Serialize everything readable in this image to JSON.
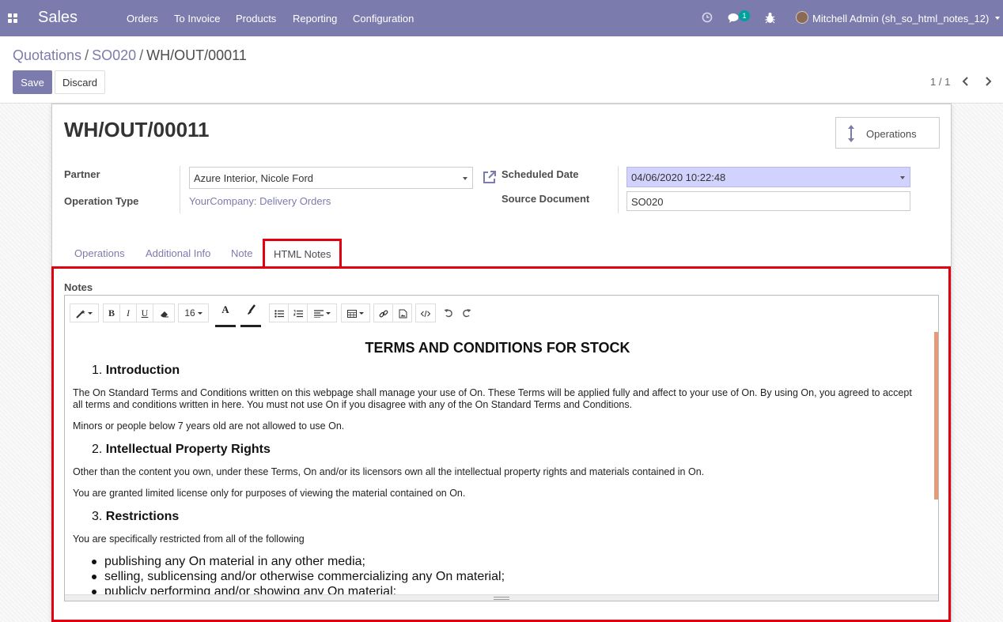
{
  "navbar": {
    "brand": "Sales",
    "menu": [
      "Orders",
      "To Invoice",
      "Products",
      "Reporting",
      "Configuration"
    ],
    "chat_badge": "1",
    "user": "Mitchell Admin (sh_so_html_notes_12)"
  },
  "breadcrumb": {
    "items": [
      "Quotations",
      "SO020"
    ],
    "separator": "/",
    "current": "WH/OUT/00011"
  },
  "actions": {
    "save": "Save",
    "discard": "Discard"
  },
  "pager": {
    "value": "1 / 1"
  },
  "record": {
    "title": "WH/OUT/00011",
    "smart_button": "Operations",
    "partner_label": "Partner",
    "partner_value": "Azure Interior, Nicole Ford",
    "operation_type_label": "Operation Type",
    "operation_type_value": "YourCompany: Delivery Orders",
    "scheduled_date_label": "Scheduled Date",
    "scheduled_date_value": "04/06/2020 10:22:48",
    "source_document_label": "Source Document",
    "source_document_value": "SO020"
  },
  "tabs": [
    "Operations",
    "Additional Info",
    "Note",
    "HTML Notes"
  ],
  "active_tab": "HTML Notes",
  "notes": {
    "label": "Notes",
    "font_size": "16",
    "toolbar_icons": [
      "magic-wand-icon",
      "bold-icon",
      "italic-icon",
      "underline-icon",
      "eraser-icon",
      "font-color-icon",
      "paint-brush-icon",
      "unordered-list-icon",
      "ordered-list-icon",
      "align-icon",
      "table-icon",
      "link-icon",
      "image-icon",
      "code-view-icon",
      "undo-icon",
      "redo-icon"
    ],
    "heading": "TERMS AND CONDITIONS FOR STOCK",
    "sections": [
      {
        "number": "1.",
        "title": "Introduction",
        "paragraphs": [
          "The On Standard Terms and Conditions written on this webpage shall manage your use of On. These Terms will be applied fully and affect to your use of On. By using On, you agreed to accept all terms and conditions written in here. You must not use On if you disagree with any of the On Standard Terms and Conditions.",
          "Minors or people below 7 years old are not allowed to use On."
        ]
      },
      {
        "number": "2.",
        "title": "Intellectual Property Rights",
        "paragraphs": [
          "Other than the content you own, under these Terms, On and/or its licensors own all the intellectual property rights and materials contained in On.",
          "You are granted limited license only for purposes of viewing the material contained on On."
        ]
      },
      {
        "number": "3.",
        "title": "Restrictions",
        "paragraphs": [
          "You are specifically restricted from all of the following"
        ]
      }
    ],
    "bullets": [
      "publishing any On material in any other media;",
      "selling, sublicensing and/or otherwise commercializing any On material;",
      "publicly performing and/or showing any On material;"
    ]
  },
  "colors": {
    "brand": "#7c7bad",
    "highlight_box": "#e0000f",
    "required_field": "#d2d2ff",
    "badge": "#00a09d"
  }
}
